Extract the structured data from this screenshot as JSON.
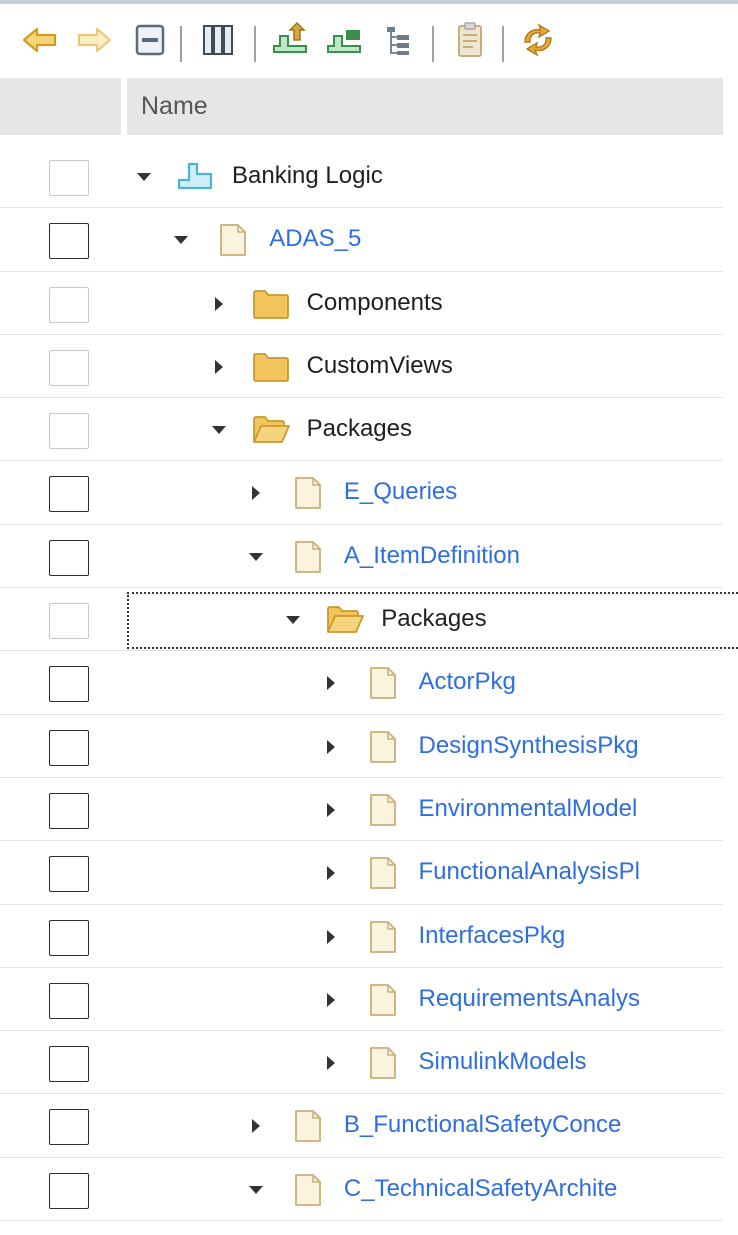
{
  "toolbar": {
    "buttons": [
      {
        "name": "back-icon"
      },
      {
        "name": "forward-icon"
      },
      {
        "name": "collapse-all-icon"
      },
      {
        "name": "columns-icon"
      },
      {
        "name": "add-item-up-icon"
      },
      {
        "name": "add-item-down-icon"
      },
      {
        "name": "hierarchy-icon"
      },
      {
        "name": "clipboard-icon"
      },
      {
        "name": "refresh-icon"
      }
    ]
  },
  "header": {
    "name_label": "Name"
  },
  "tree": {
    "rows": [
      {
        "label": "Banking Logic",
        "depth": 0,
        "icon": "component-icon",
        "twisty": "expanded",
        "style": "dark",
        "checkbox": "disabled"
      },
      {
        "label": "ADAS_5",
        "depth": 1,
        "icon": "package-icon",
        "twisty": "expanded",
        "style": "link",
        "checkbox": "active"
      },
      {
        "label": "Components",
        "depth": 2,
        "icon": "folder-icon",
        "twisty": "collapsed",
        "style": "dark",
        "checkbox": "disabled"
      },
      {
        "label": "CustomViews",
        "depth": 2,
        "icon": "folder-icon",
        "twisty": "collapsed",
        "style": "dark",
        "checkbox": "disabled"
      },
      {
        "label": "Packages",
        "depth": 2,
        "icon": "open-folder-icon",
        "twisty": "expanded",
        "style": "dark",
        "checkbox": "disabled"
      },
      {
        "label": "E_Queries",
        "depth": 3,
        "icon": "package-icon",
        "twisty": "collapsed",
        "style": "link",
        "checkbox": "active"
      },
      {
        "label": "A_ItemDefinition",
        "depth": 3,
        "icon": "package-icon",
        "twisty": "expanded",
        "style": "link",
        "checkbox": "active"
      },
      {
        "label": "Packages",
        "depth": 4,
        "icon": "open-folder-icon",
        "twisty": "expanded",
        "style": "dark",
        "checkbox": "disabled",
        "focused": true
      },
      {
        "label": "ActorPkg",
        "depth": 5,
        "icon": "package-icon",
        "twisty": "collapsed",
        "style": "link",
        "checkbox": "active"
      },
      {
        "label": "DesignSynthesisPkg",
        "depth": 5,
        "icon": "package-icon",
        "twisty": "collapsed",
        "style": "link",
        "checkbox": "active"
      },
      {
        "label": "EnvironmentalModel",
        "depth": 5,
        "icon": "package-icon",
        "twisty": "collapsed",
        "style": "link",
        "checkbox": "active"
      },
      {
        "label": "FunctionalAnalysisPl",
        "depth": 5,
        "icon": "package-icon",
        "twisty": "collapsed",
        "style": "link",
        "checkbox": "active"
      },
      {
        "label": "InterfacesPkg",
        "depth": 5,
        "icon": "package-icon",
        "twisty": "collapsed",
        "style": "link",
        "checkbox": "active"
      },
      {
        "label": "RequirementsAnalys",
        "depth": 5,
        "icon": "package-icon",
        "twisty": "collapsed",
        "style": "link",
        "checkbox": "active"
      },
      {
        "label": "SimulinkModels",
        "depth": 5,
        "icon": "package-icon",
        "twisty": "collapsed",
        "style": "link",
        "checkbox": "active"
      },
      {
        "label": "B_FunctionalSafetyConce",
        "depth": 3,
        "icon": "package-icon",
        "twisty": "collapsed",
        "style": "link",
        "checkbox": "active"
      },
      {
        "label": "C_TechnicalSafetyArchite",
        "depth": 3,
        "icon": "package-icon",
        "twisty": "expanded",
        "style": "link",
        "checkbox": "active"
      }
    ]
  },
  "colors": {
    "link": "#2f6ee0",
    "text": "#1f1f1f",
    "folder": "#f2c45c",
    "folder_stroke": "#c89a2e",
    "package_fill": "#fbf3de",
    "package_stroke": "#c9ae78",
    "component": "#4fb3cf",
    "focus": "#333333"
  }
}
